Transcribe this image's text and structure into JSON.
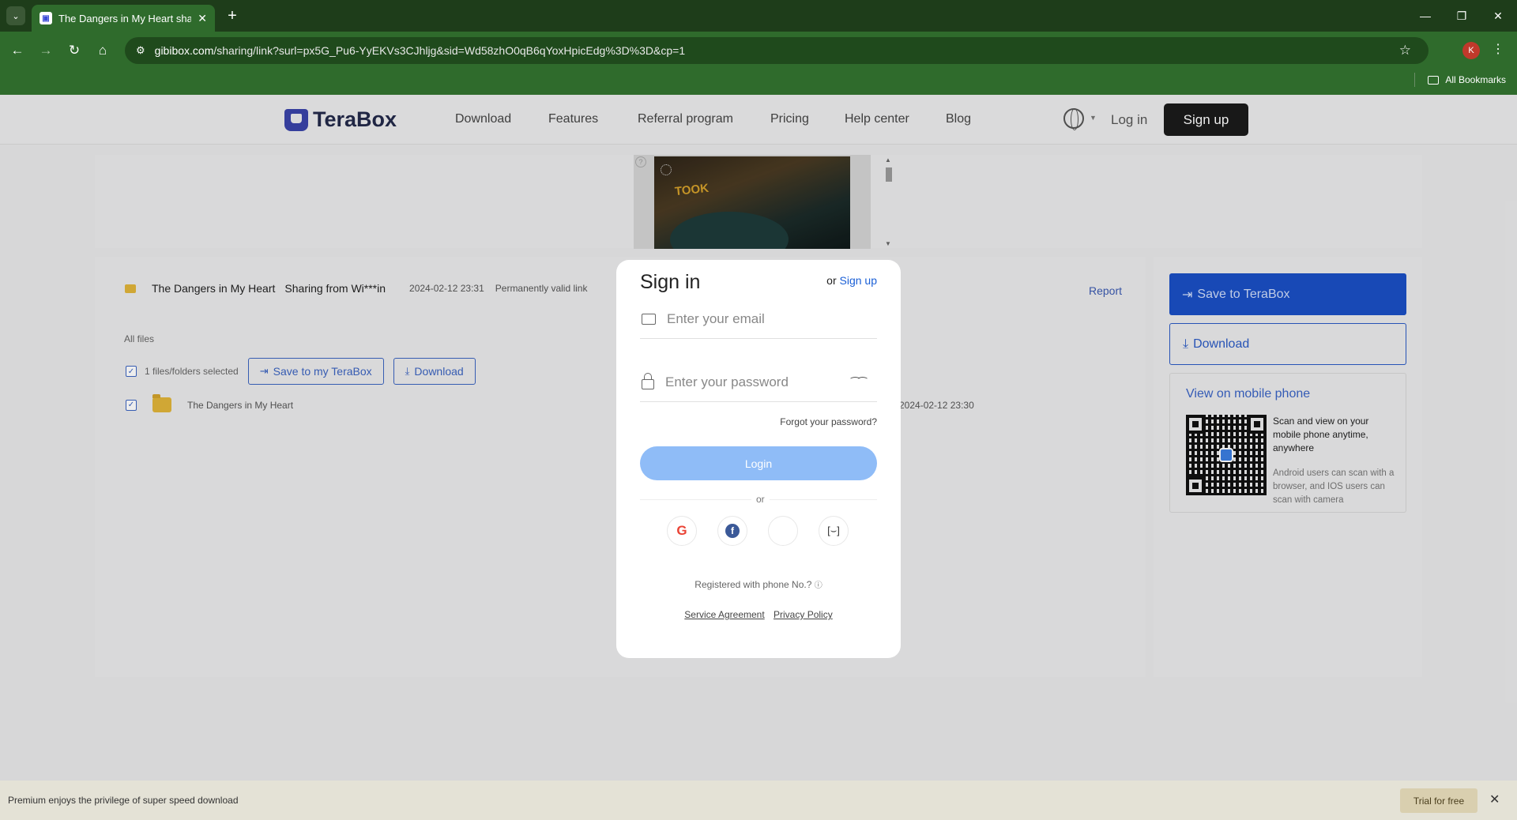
{
  "browser": {
    "tab_title": "The Dangers in My Heart share",
    "url_host": "gibibox.com",
    "url_path": "/sharing/link?surl=px5G_Pu6-YyEKVs3CJhljg&sid=Wd58zhO0qB6qYoxHpicEdg%3D%3D&cp=1",
    "profile_initial": "K",
    "bookmarks_label": "All Bookmarks"
  },
  "header": {
    "logo_text": "TeraBox",
    "nav": [
      "Download",
      "Features",
      "Referral program",
      "Pricing",
      "Help center",
      "Blog"
    ],
    "login": "Log in",
    "signup": "Sign up"
  },
  "share": {
    "folder_name": "The Dangers in My Heart",
    "sharing_from": "Sharing from Wi***in",
    "date": "2024-02-12 23:31",
    "validity": "Permanently valid link",
    "report": "Report",
    "all_files": "All files",
    "selected_count": "1 files/folders selected",
    "save_btn": "Save to my TeraBox",
    "download_btn": "Download",
    "file_name": "The Dangers in My Heart",
    "file_date": "2024-02-12 23:30"
  },
  "side": {
    "save_btn": "Save to TeraBox",
    "download_btn": "Download",
    "mobile_title": "View on mobile phone",
    "mobile_text1": "Scan and view on your mobile phone anytime, anywhere",
    "mobile_text2": "Android users can scan with a browser, and IOS users can scan with camera"
  },
  "modal": {
    "title": "Sign in",
    "or_prefix": "or",
    "signup_link": "Sign up",
    "email_placeholder": "Enter your email",
    "password_placeholder": "Enter your password",
    "forgot": "Forgot your password?",
    "login_btn": "Login",
    "or_text": "or",
    "phone_text": "Registered with phone No.?",
    "service_agreement": "Service Agreement",
    "privacy_policy": "Privacy Policy"
  },
  "bottom": {
    "message": "Premium enjoys the privilege of super speed download",
    "trial_btn": "Trial for free"
  },
  "ad": {
    "sign_text": "TOOK"
  }
}
